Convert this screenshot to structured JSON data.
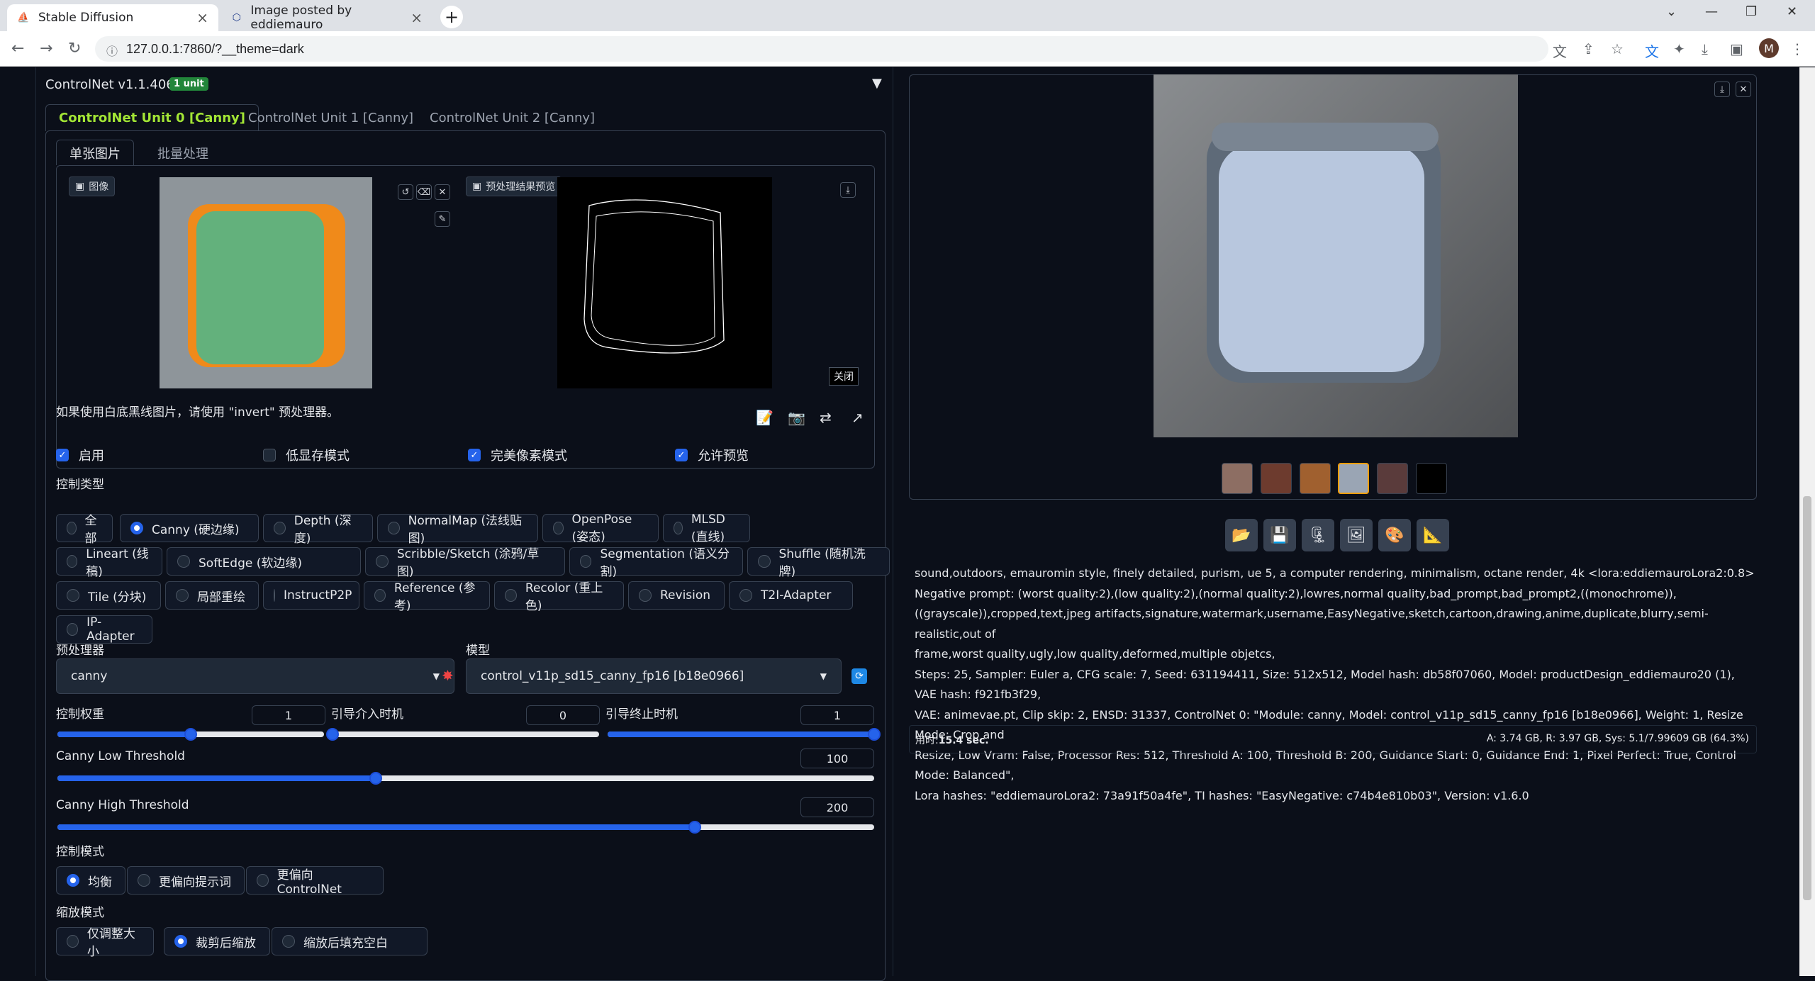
{
  "browser": {
    "tabs": [
      {
        "title": "Stable Diffusion",
        "icon": "stable-diffusion-favicon"
      },
      {
        "title": "Image posted by eddiemauro",
        "icon": "civitai-favicon"
      }
    ],
    "url": "127.0.0.1:7860/?__theme=dark",
    "avatar_letter": "M"
  },
  "controlnet": {
    "title": "ControlNet v1.1.406",
    "badge": "1 unit",
    "units": [
      "ControlNet Unit 0 [Canny]",
      "ControlNet Unit 1 [Canny]",
      "ControlNet Unit 2 [Canny]"
    ],
    "subtabs": [
      "单张图片",
      "批量处理"
    ],
    "image_label": "图像",
    "preview_label": "预处理结果预览",
    "close_label": "关闭",
    "hint": "如果使用白底黑线图片，请使用 \"invert\" 预处理器。",
    "checks": [
      {
        "label": "启用",
        "on": true
      },
      {
        "label": "低显存模式",
        "on": false
      },
      {
        "label": "完美像素模式",
        "on": true
      },
      {
        "label": "允许预览",
        "on": true
      }
    ],
    "control_type_label": "控制类型",
    "control_types": [
      "全部",
      "Canny (硬边缘)",
      "Depth (深度)",
      "NormalMap (法线贴图)",
      "OpenPose (姿态)",
      "MLSD (直线)",
      "Lineart (线稿)",
      "SoftEdge (软边缘)",
      "Scribble/Sketch (涂鸦/草图)",
      "Segmentation (语义分割)",
      "Shuffle (随机洗牌)",
      "Tile (分块)",
      "局部重绘",
      "InstructP2P",
      "Reference (参考)",
      "Recolor (重上色)",
      "Revision",
      "T2I-Adapter",
      "IP-Adapter"
    ],
    "preprocessor_label": "预处理器",
    "preprocessor": "canny",
    "model_label": "模型",
    "model": "control_v11p_sd15_canny_fp16 [b18e0966]",
    "weight_label": "控制权重",
    "weight": "1",
    "start_label": "引导介入时机",
    "start": "0",
    "end_label": "引导终止时机",
    "end": "1",
    "low_label": "Canny Low Threshold",
    "low": "100",
    "high_label": "Canny High Threshold",
    "high": "200",
    "mode_label": "控制模式",
    "modes": [
      "均衡",
      "更偏向提示词",
      "更偏向 ControlNet"
    ],
    "resize_label": "缩放模式",
    "resizes": [
      "仅调整大小",
      "裁剪后缩放",
      "缩放后填充空白"
    ],
    "levels": {
      "weight": 0.5,
      "start": 0.0,
      "end": 1.0,
      "low": 0.39,
      "high": 0.78
    }
  },
  "output": {
    "info_lines": [
      "sound,outdoors, emauromin style, finely detailed, purism, ue 5, a computer rendering, minimalism, octane render, 4k <lora:eddiemauroLora2:0.8>",
      "Negative prompt: (worst quality:2),(low quality:2),(normal quality:2),lowres,normal quality,bad_prompt,bad_prompt2,((monochrome)),",
      "((grayscale)),cropped,text,jpeg artifacts,signature,watermark,username,EasyNegative,sketch,cartoon,drawing,anime,duplicate,blurry,semi-realistic,out of",
      "frame,worst quality,ugly,low quality,deformed,multiple objetcs,",
      "Steps: 25, Sampler: Euler a, CFG scale: 7, Seed: 631194411, Size: 512x512, Model hash: db58f07060, Model: productDesign_eddiemauro20 (1), VAE hash: f921fb3f29,",
      "VAE: animevae.pt, Clip skip: 2, ENSD: 31337, ControlNet 0: \"Module: canny, Model: control_v11p_sd15_canny_fp16 [b18e0966], Weight: 1, Resize Mode: Crop and",
      "Resize, Low Vram: False, Processor Res: 512, Threshold A: 100, Threshold B: 200, Guidance Start: 0, Guidance End: 1, Pixel Perfect: True, Control Mode: Balanced\",",
      "Lora hashes: \"eddiemauroLora2: 73a91f50a4fe\", TI hashes: \"EasyNegative: c74b4e810b03\", Version: v1.6.0"
    ],
    "time_label": "用时:",
    "time": "15.4 sec.",
    "vram": "A: 3.74 GB, R: 3.97 GB, Sys: 5.1/7.99609 GB (64.3%)"
  }
}
